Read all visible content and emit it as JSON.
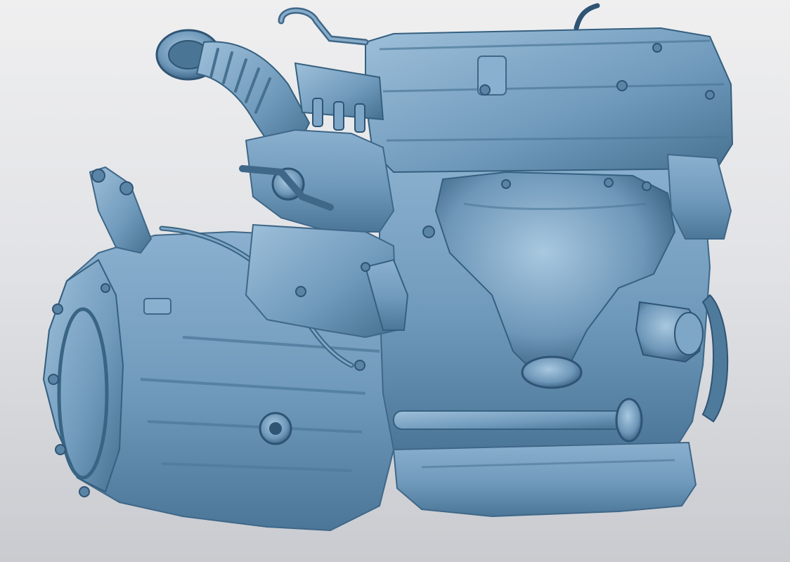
{
  "scene": {
    "subject": "3d-scan-engine-transmission",
    "colors": {
      "background_top": "#efeff0",
      "background_bottom": "#c9cbd0",
      "model_base": "#6f99bb",
      "model_light": "#9ec0da",
      "model_mid": "#5f89ab",
      "model_shadow": "#3f6788",
      "model_dark": "#2f5474"
    },
    "icons": [
      "engine-icon",
      "transmission-icon",
      "air-intake-icon",
      "oil-filter-icon",
      "flywheel-icon"
    ]
  }
}
